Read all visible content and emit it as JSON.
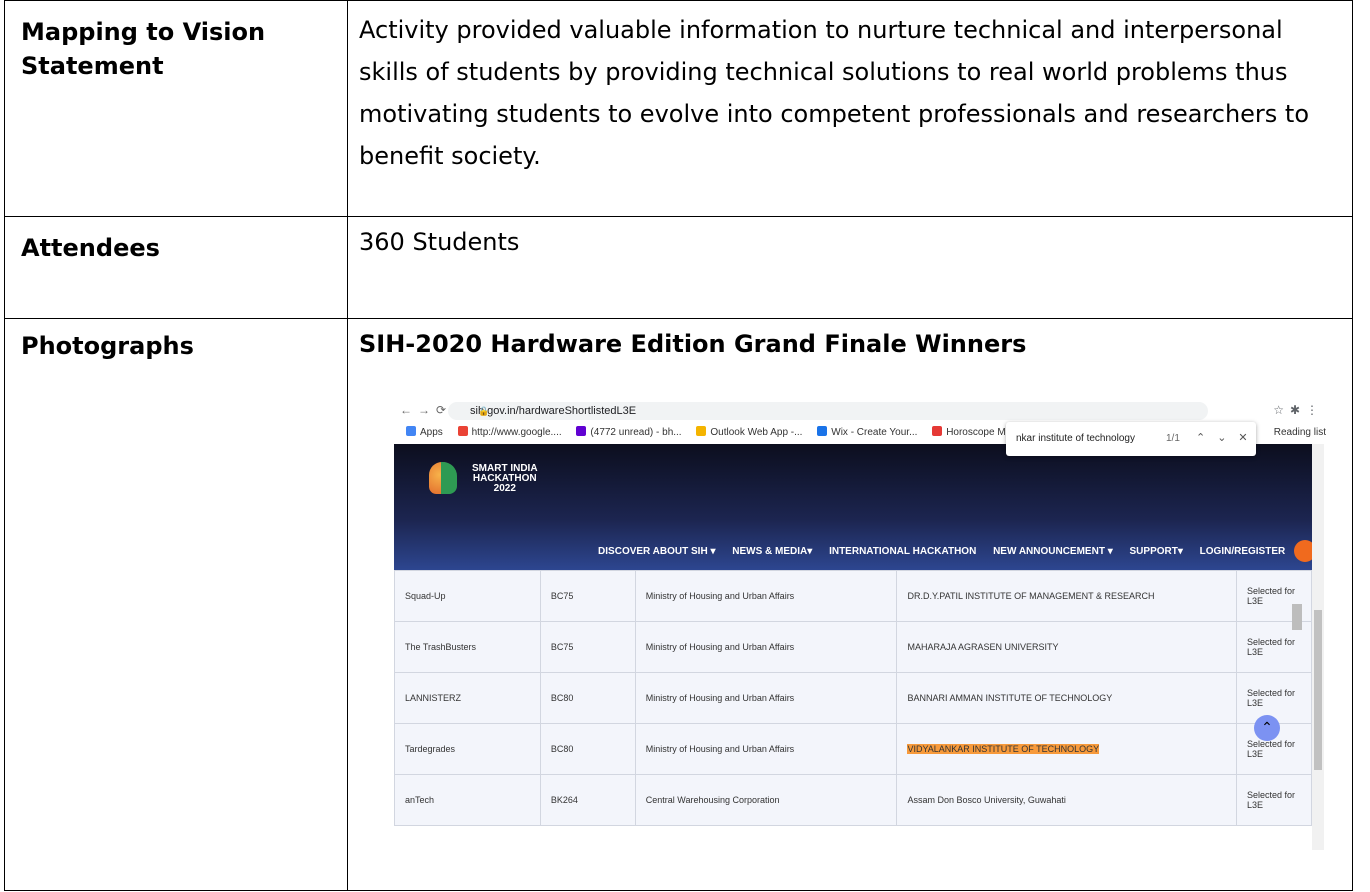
{
  "rows": [
    {
      "label": "Mapping to Vision Statement",
      "text": "Activity provided valuable information to nurture technical and interpersonal skills of students by providing technical solutions to real world problems thus motivating students to evolve into competent professionals and researchers to benefit society."
    },
    {
      "label": "Attendees",
      "text": "360 Students"
    },
    {
      "label": "Photographs",
      "heading": "SIH-2020  Hardware Edition Grand Finale Winners"
    }
  ],
  "browser": {
    "url": "sih.gov.in/hardwareShortlistedL3E",
    "bookmarks": [
      "Apps",
      "http://www.google....",
      "(4772 unread) - bh...",
      "Outlook Web App -...",
      "Wix - Create Your...",
      "Horoscope Matchin..."
    ],
    "reading_list": "Reading list",
    "find_query": "nkar institute of technology",
    "find_count": "1/1"
  },
  "site": {
    "logo_lines": [
      "SMART INDIA",
      "HACKATHON",
      "2022"
    ],
    "menu": [
      "DISCOVER ABOUT SIH ▾",
      "NEWS & MEDIA▾",
      "INTERNATIONAL HACKATHON",
      "NEW ANNOUNCEMENT ▾",
      "SUPPORT▾",
      "LOGIN/REGISTER"
    ]
  },
  "table_rows": [
    {
      "team": "Squad-Up",
      "code": "BC75",
      "ministry": "Ministry of Housing and Urban Affairs",
      "institute": "DR.D.Y.PATIL INSTITUTE OF MANAGEMENT & RESEARCH",
      "status": "Selected for L3E"
    },
    {
      "team": "The TrashBusters",
      "code": "BC75",
      "ministry": "Ministry of Housing and Urban Affairs",
      "institute": "MAHARAJA AGRASEN UNIVERSITY",
      "status": "Selected for L3E"
    },
    {
      "team": "LANNISTERZ",
      "code": "BC80",
      "ministry": "Ministry of Housing and Urban Affairs",
      "institute": "BANNARI AMMAN INSTITUTE OF TECHNOLOGY",
      "status": "Selected for L3E"
    },
    {
      "team": "Tardegrades",
      "code": "BC80",
      "ministry": "Ministry of Housing and Urban Affairs",
      "institute": "VIDYALANKAR INSTITUTE OF TECHNOLOGY",
      "status": "Selected for L3E"
    },
    {
      "team": "anTech",
      "code": "BK264",
      "ministry": "Central Warehousing Corporation",
      "institute": "Assam Don Bosco University, Guwahati",
      "status": "Selected for L3E"
    }
  ],
  "colors": {
    "highlight": "#f79a3b",
    "header_dark": "#0c0e1e",
    "header_blue": "#2d4690",
    "user_icon": "#f06a1e"
  }
}
